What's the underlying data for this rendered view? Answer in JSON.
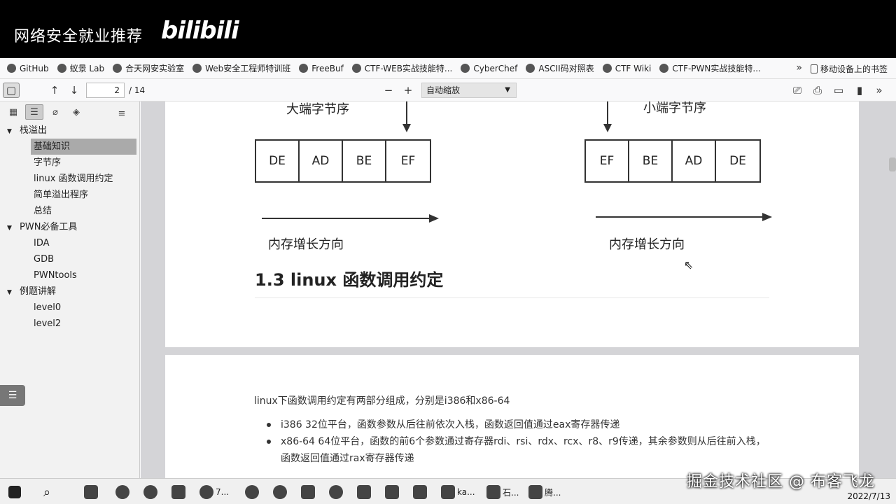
{
  "banner": {
    "title": "网络安全就业推荐",
    "logo": "bilibili"
  },
  "bookmarks": [
    {
      "label": "GitHub",
      "icon": "github-icon"
    },
    {
      "label": "蚁景 Lab",
      "icon": "lab-icon"
    },
    {
      "label": "合天网安实验室",
      "icon": "shield-icon"
    },
    {
      "label": "Web安全工程师特训班",
      "icon": "diamond-icon"
    },
    {
      "label": "FreeBuf",
      "icon": "freebuf-icon"
    },
    {
      "label": "CTF-WEB实战技能特...",
      "icon": "diamond-icon"
    },
    {
      "label": "CyberChef",
      "icon": "chef-icon"
    },
    {
      "label": "ASCII码对照表",
      "icon": "c-icon"
    },
    {
      "label": "CTF Wiki",
      "icon": "wiki-icon"
    },
    {
      "label": "CTF-PWN实战技能特...",
      "icon": "diamond-icon"
    }
  ],
  "bookmarks_more": "»",
  "bookmarks_mobile": "移动设备上的书签",
  "toolbar": {
    "page_current": "2",
    "page_total": "/ 14",
    "zoom": "自动缩放",
    "minus": "−",
    "plus": "+"
  },
  "outline": [
    {
      "label": "栈溢出",
      "level": 0
    },
    {
      "label": "基础知识",
      "level": 1,
      "selected": true
    },
    {
      "label": "字节序",
      "level": 1
    },
    {
      "label": "linux 函数调用约定",
      "level": 1
    },
    {
      "label": "简单溢出程序",
      "level": 1
    },
    {
      "label": "总结",
      "level": 1
    },
    {
      "label": "PWN必备工具",
      "level": 0
    },
    {
      "label": "IDA",
      "level": 1
    },
    {
      "label": "GDB",
      "level": 1
    },
    {
      "label": "PWNtools",
      "level": 1
    },
    {
      "label": "例题讲解",
      "level": 0
    },
    {
      "label": "level0",
      "level": 1
    },
    {
      "label": "level2",
      "level": 1
    }
  ],
  "page1": {
    "big_endian_label": "大端字节序",
    "little_endian_label": "小端字节序",
    "big_endian_bytes": [
      "DE",
      "AD",
      "BE",
      "EF"
    ],
    "little_endian_bytes": [
      "EF",
      "BE",
      "AD",
      "DE"
    ],
    "growth_label_left": "内存增长方向",
    "growth_label_right": "内存增长方向",
    "section_title": "1.3 linux 函数调用约定"
  },
  "page2": {
    "intro": "linux下函数调用约定有两部分组成，分别是i386和x86-64",
    "items": [
      "i386 32位平台，函数参数从后往前依次入栈，函数返回值通过eax寄存器传递",
      "x86-64  64位平台，函数的前6个参数通过寄存器rdi、rsi、rdx、rcx、r8、r9传递，其余参数则从后往前入栈，函数返回值通过rax寄存器传递"
    ]
  },
  "taskbar": {
    "items": [
      "7...",
      "ka...",
      "石...",
      "腾..."
    ],
    "date": "2022/7/13"
  },
  "watermark": "掘金技术社区 @ 布客飞龙"
}
